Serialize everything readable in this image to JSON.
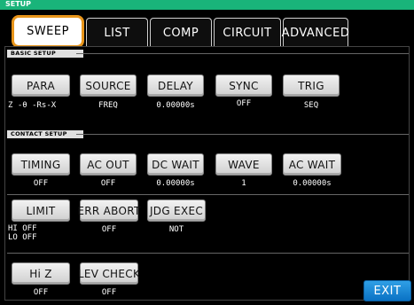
{
  "window": {
    "title": "SETUP"
  },
  "tabs": [
    {
      "label": "SWEEP",
      "active": true
    },
    {
      "label": "LIST"
    },
    {
      "label": "COMP"
    },
    {
      "label": "CIRCUIT"
    },
    {
      "label": "ADVANCED"
    }
  ],
  "basic_setup": {
    "label": "BASIC SETUP",
    "buttons": [
      {
        "label": "PARA",
        "value": "Z -θ -Rs-X"
      },
      {
        "label": "SOURCE",
        "value": "FREQ"
      },
      {
        "label": "DELAY",
        "value": "0.00000s"
      },
      {
        "label": "SYNC",
        "value": "OFF"
      },
      {
        "label": "TRIG",
        "value": "SEQ"
      }
    ]
  },
  "contact_setup": {
    "label": "CONTACT SETUP",
    "row1": [
      {
        "label": "TIMING",
        "value": "OFF"
      },
      {
        "label": "AC OUT",
        "value": "OFF"
      },
      {
        "label": "DC WAIT",
        "value": "0.00000s"
      },
      {
        "label": "WAVE",
        "value": "1"
      },
      {
        "label": "AC WAIT",
        "value": "0.00000s"
      }
    ],
    "row2": [
      {
        "label": "LIMIT",
        "value_line1": "HI OFF",
        "value_line2": "LO OFF"
      },
      {
        "label": "ERR ABORT",
        "value": "OFF"
      },
      {
        "label": "JDG EXEC",
        "value": "NOT"
      }
    ],
    "row3": [
      {
        "label": "Hi Z",
        "value": "OFF"
      },
      {
        "label": "LEV CHECK",
        "value": "OFF"
      }
    ]
  },
  "exit_label": "EXIT",
  "colors": {
    "title_bar": "#19b47a",
    "active_tab_border": "#e8951a",
    "exit_button": "#1a86d6"
  }
}
